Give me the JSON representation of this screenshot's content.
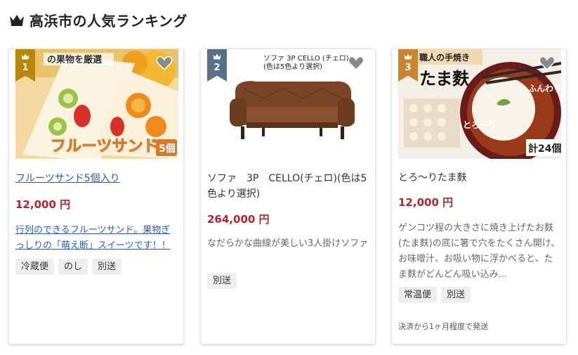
{
  "heading": {
    "title": "高浜市の人気ランキング"
  },
  "items": [
    {
      "rank": "1",
      "title": "フルーツサンド5個入り",
      "price": "12,000 円",
      "desc": "行列のできるフルーツサンド。果物ぎっしりの「萌え断」スイーツです！！",
      "tags": [
        "冷蔵便",
        "のし",
        "別送"
      ],
      "image": {
        "caption": "フルーツサンド",
        "count": "5個",
        "overlay": "の果物を厳選"
      }
    },
    {
      "rank": "2",
      "title": "ソファ　3P　CELLO(チェロ)(色は5色より選択)",
      "price": "264,000 円",
      "desc": "なだらかな曲線が美しい3人掛けソファ",
      "tags": [
        "別送"
      ],
      "image": {
        "caption": "ソファ 3P CELLO (チェロ)\n(色は5色より選択)"
      }
    },
    {
      "rank": "3",
      "title": "とろ〜りたま麩",
      "price": "12,000 円",
      "desc": "ゲンコツ程の大きさに焼き上げたお麩(たま麩)の底に箸で穴をたくさん開け、お味噌汁、お吸い物に浮かべると、たま麩がどんどん吸い込み...",
      "tags": [
        "常温便",
        "別送"
      ],
      "note": "決済から1ヶ月程度で発送",
      "image": {
        "banner": "職人の手焼き",
        "big": "たま麩",
        "side1": "ふんわり",
        "side2": "とろ〜り",
        "count": "計24個"
      }
    }
  ],
  "colors": {
    "rank1": "#b8860b",
    "rank2": "#5a6f8a",
    "rank3": "#c7852f",
    "price": "#b3242c",
    "link": "#2a5db0"
  }
}
